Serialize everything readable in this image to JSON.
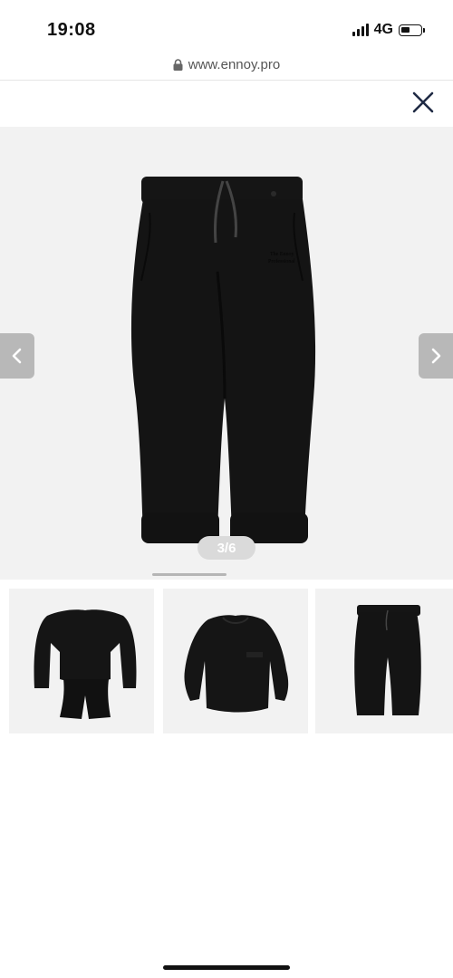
{
  "status_bar": {
    "time": "19:08",
    "network": "4G"
  },
  "browser": {
    "url": "www.ennoy.pro"
  },
  "gallery": {
    "counter": "3/6",
    "main_image": {
      "subject": "black sweatpants",
      "print": [
        "The Ennoy",
        "Professional"
      ]
    },
    "thumbnails": [
      {
        "subject": "black sweatshirt and sweatpants set"
      },
      {
        "subject": "black crewneck sweatshirt"
      },
      {
        "subject": "black sweatpants"
      }
    ]
  },
  "icons": {
    "close": "close-icon",
    "prev": "chevron-left-icon",
    "next": "chevron-right-icon",
    "lock": "lock-icon"
  },
  "colors": {
    "accent_close": "#1f2a44",
    "garment": "#141414",
    "image_bg": "#f2f2f2",
    "arrow_bg": "#b8b8b8"
  }
}
